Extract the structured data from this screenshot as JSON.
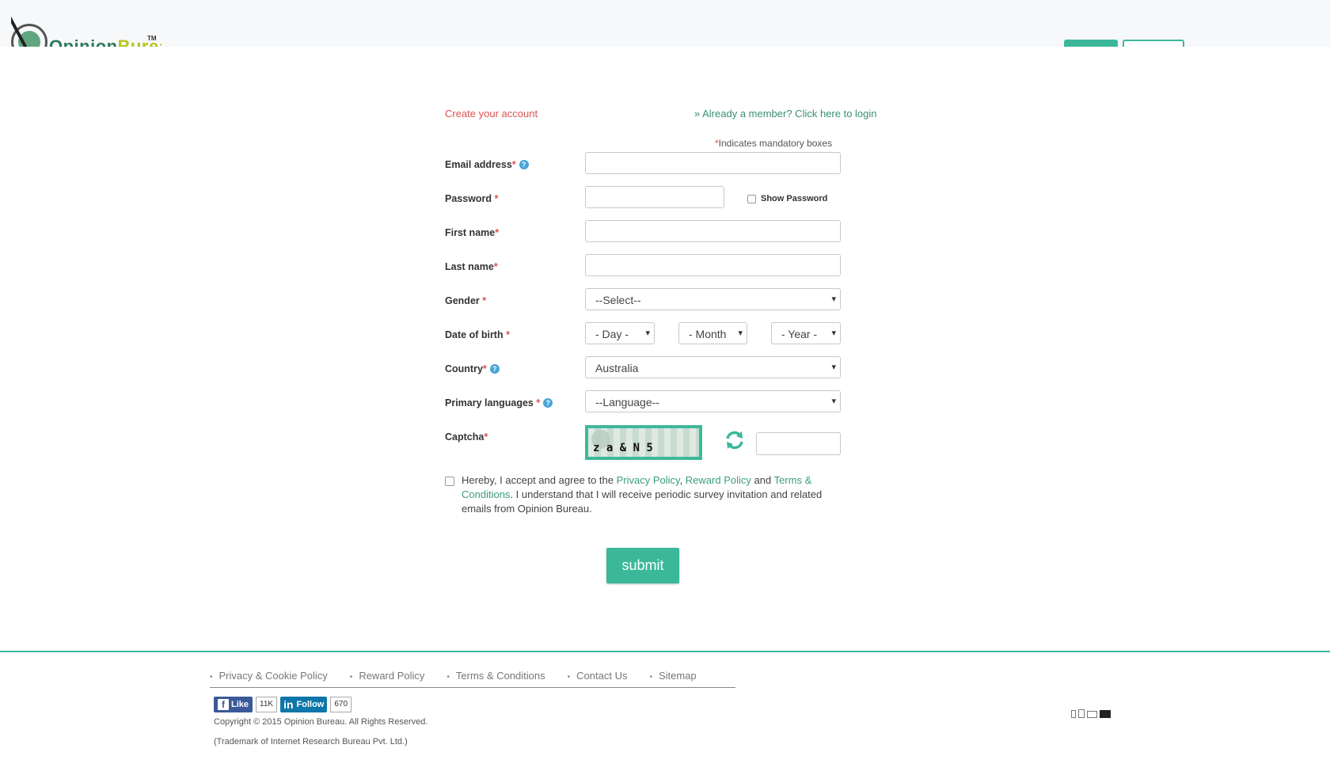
{
  "header": {
    "logo_text_1": "Opinion",
    "logo_text_2": "Bureau",
    "logo_tm": "TM"
  },
  "form": {
    "title": "Create your account",
    "login_link": "» Already a member? Click here to login",
    "mandatory_star": "*",
    "mandatory_text": "Indicates mandatory boxes",
    "fields": {
      "email": {
        "label": "Email address",
        "req": "*"
      },
      "password": {
        "label": "Password ",
        "req": "*"
      },
      "show_password": "Show Password",
      "first_name": {
        "label": "First name",
        "req": "*"
      },
      "last_name": {
        "label": "Last name",
        "req": "*"
      },
      "gender": {
        "label": "Gender ",
        "req": "*",
        "value": "--Select--"
      },
      "dob": {
        "label": "Date of birth ",
        "req": "*",
        "day": "- Day -",
        "month": "- Month -",
        "year": "- Year -"
      },
      "country": {
        "label": "Country",
        "req": "*",
        "value": "Australia"
      },
      "language": {
        "label": "Primary languages ",
        "req": "*",
        "value": "--Language--"
      },
      "captcha": {
        "label": "Captcha",
        "req": "*",
        "text": "z a & N 5"
      }
    },
    "agree": {
      "prefix": "Hereby, I accept and agree to the ",
      "privacy": "Privacy Policy",
      "comma": ", ",
      "reward": "Reward Policy",
      "and": " and ",
      "terms": "Terms & Conditions",
      "suffix": ". I understand that I will receive periodic survey invitation and related emails from Opinion Bureau."
    },
    "submit_label": "submit"
  },
  "footer": {
    "nav": [
      "Privacy & Cookie Policy",
      "Reward Policy",
      "Terms & Conditions",
      "Contact Us",
      "Sitemap"
    ],
    "fb_like": "Like",
    "fb_count": "11K",
    "li_follow": "Follow",
    "li_count": "670",
    "copyright": "Copyright © 2015 Opinion Bureau. All Rights Reserved.",
    "trademark": "(Trademark of Internet Research Bureau Pvt. Ltd.)"
  },
  "colors": {
    "accent": "#3bb89a",
    "required": "#d9534f",
    "link": "#3a8f73"
  },
  "icons": [
    "logo-icon",
    "help-icon",
    "refresh-icon",
    "dropdown-arrow-icon",
    "facebook-icon",
    "linkedin-icon",
    "device-icons"
  ]
}
